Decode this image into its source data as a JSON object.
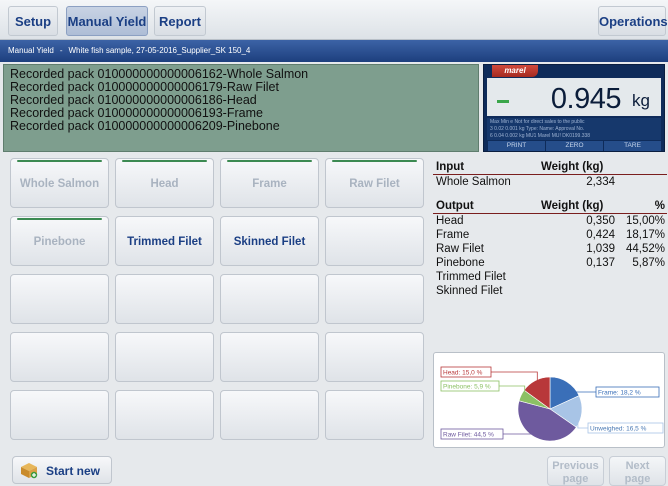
{
  "tabs": {
    "setup": "Setup",
    "manual_yield": "Manual Yield",
    "report": "Report",
    "operations": "Operations"
  },
  "path": {
    "section": "Manual Yield",
    "sample": "White fish sample, 27-05-2016_Supplier_SK 150_4"
  },
  "log": [
    "Recorded pack 010000000000006162-Whole Salmon",
    "Recorded pack 010000000000006179-Raw Filet",
    "Recorded pack 010000000000006186-Head",
    "Recorded pack 010000000000006193-Frame",
    "Recorded pack 010000000000006209-Pinebone"
  ],
  "scale": {
    "brand": "marel",
    "weight": "0.945",
    "unit": "kg",
    "spec_rows": [
      "Max  Min    e       Not for direct sales to the public",
      "3   0.02  0.001 kg   Type: Name:       Approval No.",
      "6   0.04  0.002 kg   MU1  Marel MU!    DK0199.338"
    ],
    "keys": [
      "PRINT",
      "ZERO",
      "TARE"
    ]
  },
  "products": [
    {
      "label": "Whole Salmon",
      "active": false,
      "marked": true
    },
    {
      "label": "Head",
      "active": false,
      "marked": true
    },
    {
      "label": "Frame",
      "active": false,
      "marked": true
    },
    {
      "label": "Raw Filet",
      "active": false,
      "marked": true
    },
    {
      "label": "Pinebone",
      "active": false,
      "marked": true
    },
    {
      "label": "Trimmed Filet",
      "active": true,
      "marked": false
    },
    {
      "label": "Skinned Filet",
      "active": true,
      "marked": false
    },
    {
      "label": "",
      "active": false,
      "marked": false
    },
    {
      "label": "",
      "active": false,
      "marked": false
    },
    {
      "label": "",
      "active": false,
      "marked": false
    },
    {
      "label": "",
      "active": false,
      "marked": false
    },
    {
      "label": "",
      "active": false,
      "marked": false
    },
    {
      "label": "",
      "active": false,
      "marked": false
    },
    {
      "label": "",
      "active": false,
      "marked": false
    },
    {
      "label": "",
      "active": false,
      "marked": false
    },
    {
      "label": "",
      "active": false,
      "marked": false
    },
    {
      "label": "",
      "active": false,
      "marked": false
    },
    {
      "label": "",
      "active": false,
      "marked": false
    },
    {
      "label": "",
      "active": false,
      "marked": false
    },
    {
      "label": "",
      "active": false,
      "marked": false
    }
  ],
  "table": {
    "input_header": {
      "name": "Input",
      "weight": "Weight (kg)"
    },
    "input_rows": [
      {
        "name": "Whole Salmon",
        "weight": "2,334"
      }
    ],
    "output_header": {
      "name": "Output",
      "weight": "Weight (kg)",
      "pct": "%"
    },
    "output_rows": [
      {
        "name": "Head",
        "weight": "0,350",
        "pct": "15,00%"
      },
      {
        "name": "Frame",
        "weight": "0,424",
        "pct": "18,17%"
      },
      {
        "name": "Raw Filet",
        "weight": "1,039",
        "pct": "44,52%"
      },
      {
        "name": "Pinebone",
        "weight": "0,137",
        "pct": "5,87%"
      },
      {
        "name": "Trimmed Filet",
        "weight": "",
        "pct": ""
      },
      {
        "name": "Skinned Filet",
        "weight": "",
        "pct": ""
      }
    ]
  },
  "pie": {
    "colors": {
      "frame": "#3a6fb8",
      "unweighed": "#a8c4e6",
      "raw_filet": "#6e5a9e",
      "pinebone": "#8cc064",
      "head": "#b8383a"
    },
    "slices": [
      {
        "key": "frame",
        "label": "Frame: 18,2 %",
        "value": 18.2
      },
      {
        "key": "unweighed",
        "label": "Unweighed: 16,5 %",
        "value": 16.5
      },
      {
        "key": "raw_filet",
        "label": "Raw Filet: 44,5 %",
        "value": 44.5
      },
      {
        "key": "pinebone",
        "label": "Pinebone: 5,9 %",
        "value": 5.9
      },
      {
        "key": "head",
        "label": "Head: 15,0 %",
        "value": 15.0
      }
    ]
  },
  "bottom": {
    "start_new": "Start new",
    "previous": [
      "Previous",
      "page"
    ],
    "next": [
      "Next",
      "page"
    ]
  }
}
